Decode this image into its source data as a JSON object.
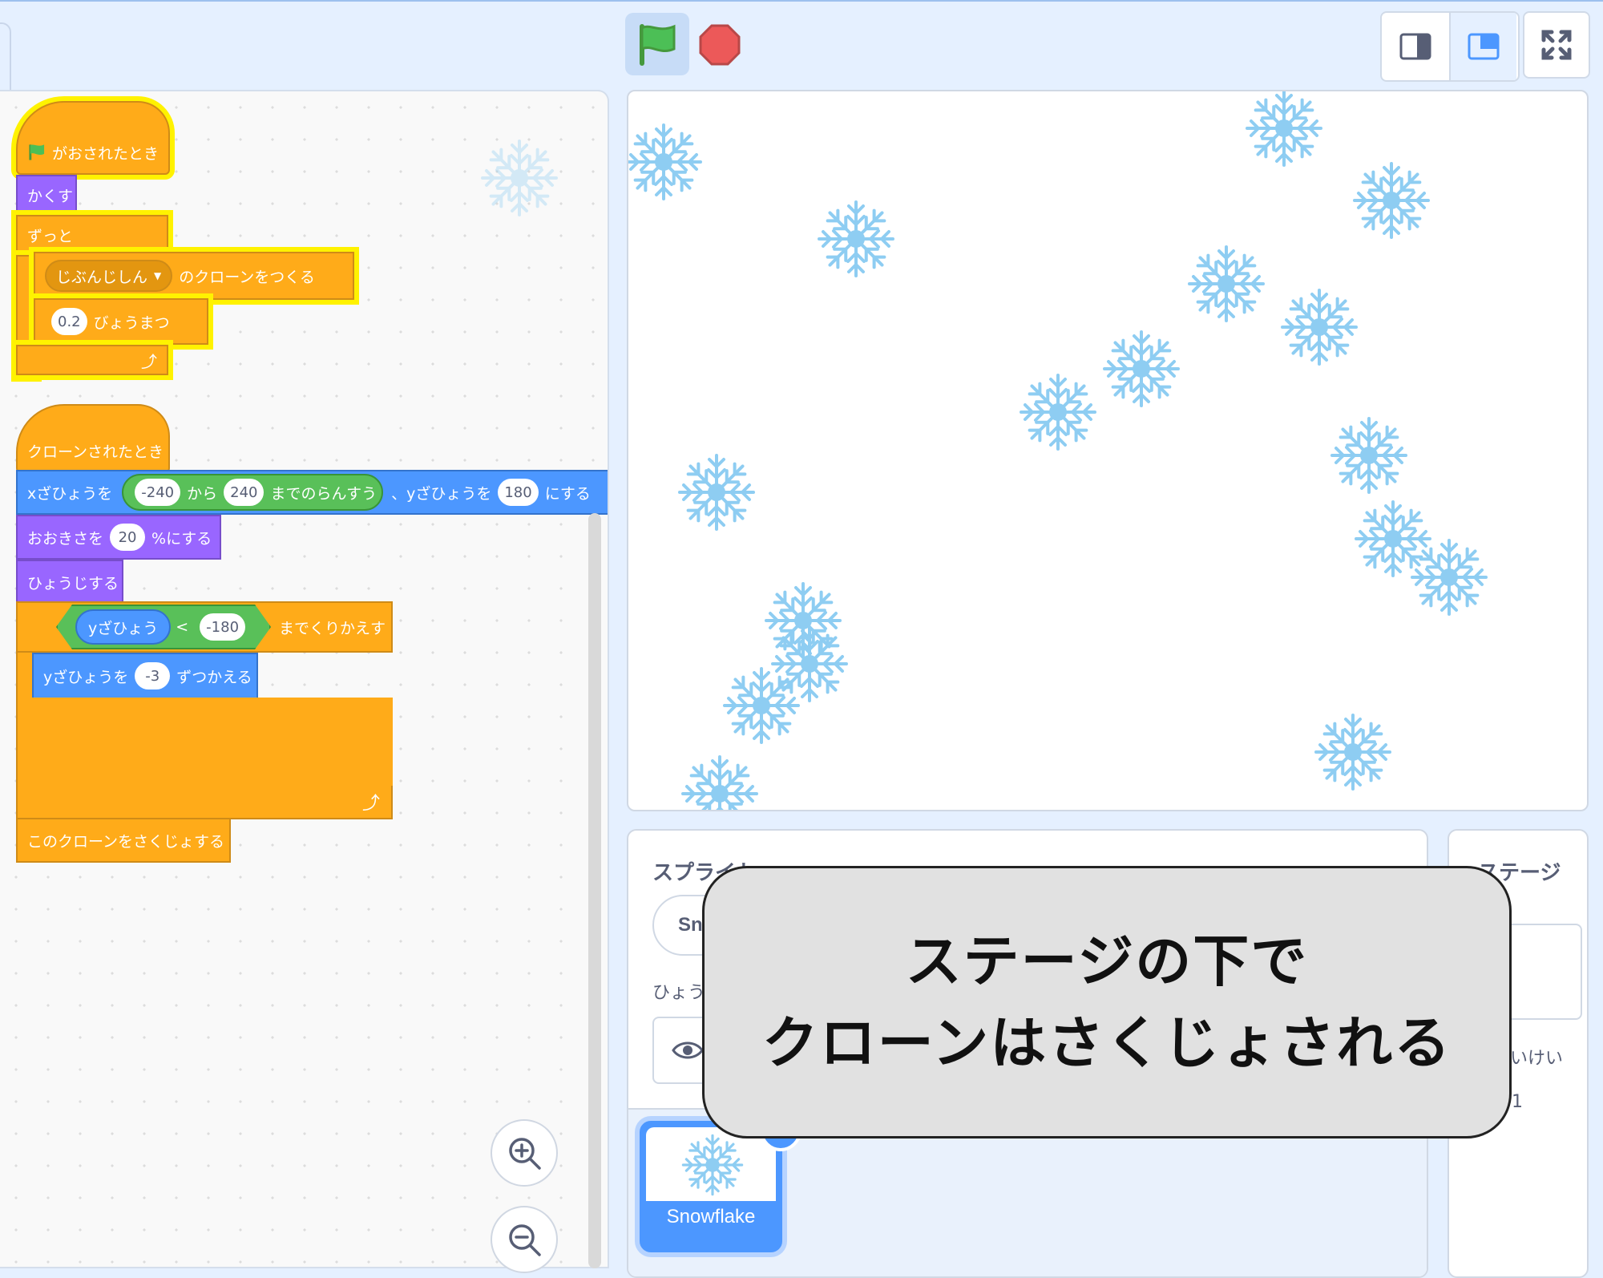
{
  "colors": {
    "events": "#ffab19",
    "looks": "#9966ff",
    "motion": "#4c97ff",
    "operators": "#59c059",
    "highlight": "#fff200",
    "flake": "#8ecdf2"
  },
  "toolbar": {
    "green_flag": "green-flag-icon",
    "stop": "stop-icon",
    "small_stage": "small-stage-icon",
    "normal_stage": "normal-stage-icon",
    "fullscreen": "fullscreen-icon"
  },
  "script1": {
    "hat_label": "がおされたとき",
    "hide": "かくす",
    "forever": "ずっと",
    "clone_target": "じぶんじしん",
    "create_clone": "のクローンをつくる",
    "wait_value": "0.2",
    "wait_label": "びょうまつ"
  },
  "script2": {
    "hat_label": "クローンされたとき",
    "goto_x_label": "xざひょうを",
    "random_from": "-240",
    "random_mid": "から",
    "random_to": "240",
    "random_end": "までのらんすう",
    "goto_y_label": "、yざひょうを",
    "goto_y_value": "180",
    "goto_end": "にする",
    "size_label": "おおきさを",
    "size_value": "20",
    "size_end": "%にする",
    "show": "ひょうじする",
    "ycoord": "yざひょう",
    "lt": "<",
    "until_value": "-180",
    "until_label": "までくりかえす",
    "change_y_label": "yざひょうを",
    "change_y_value": "-3",
    "change_y_end": "ずつかえる",
    "delete_clone": "このクローンをさくじょする"
  },
  "sprite_panel": {
    "title_visible": "スプライト",
    "name_field": "Sn",
    "show_label": "ひょう",
    "sprite_name": "Snowflake"
  },
  "stage_panel": {
    "title": "ステージ",
    "backdrops_partial": "いけい",
    "backdrop_count": "1"
  },
  "callout": {
    "line1": "ステージの下で",
    "line2": "クローンはさくじょされる"
  }
}
